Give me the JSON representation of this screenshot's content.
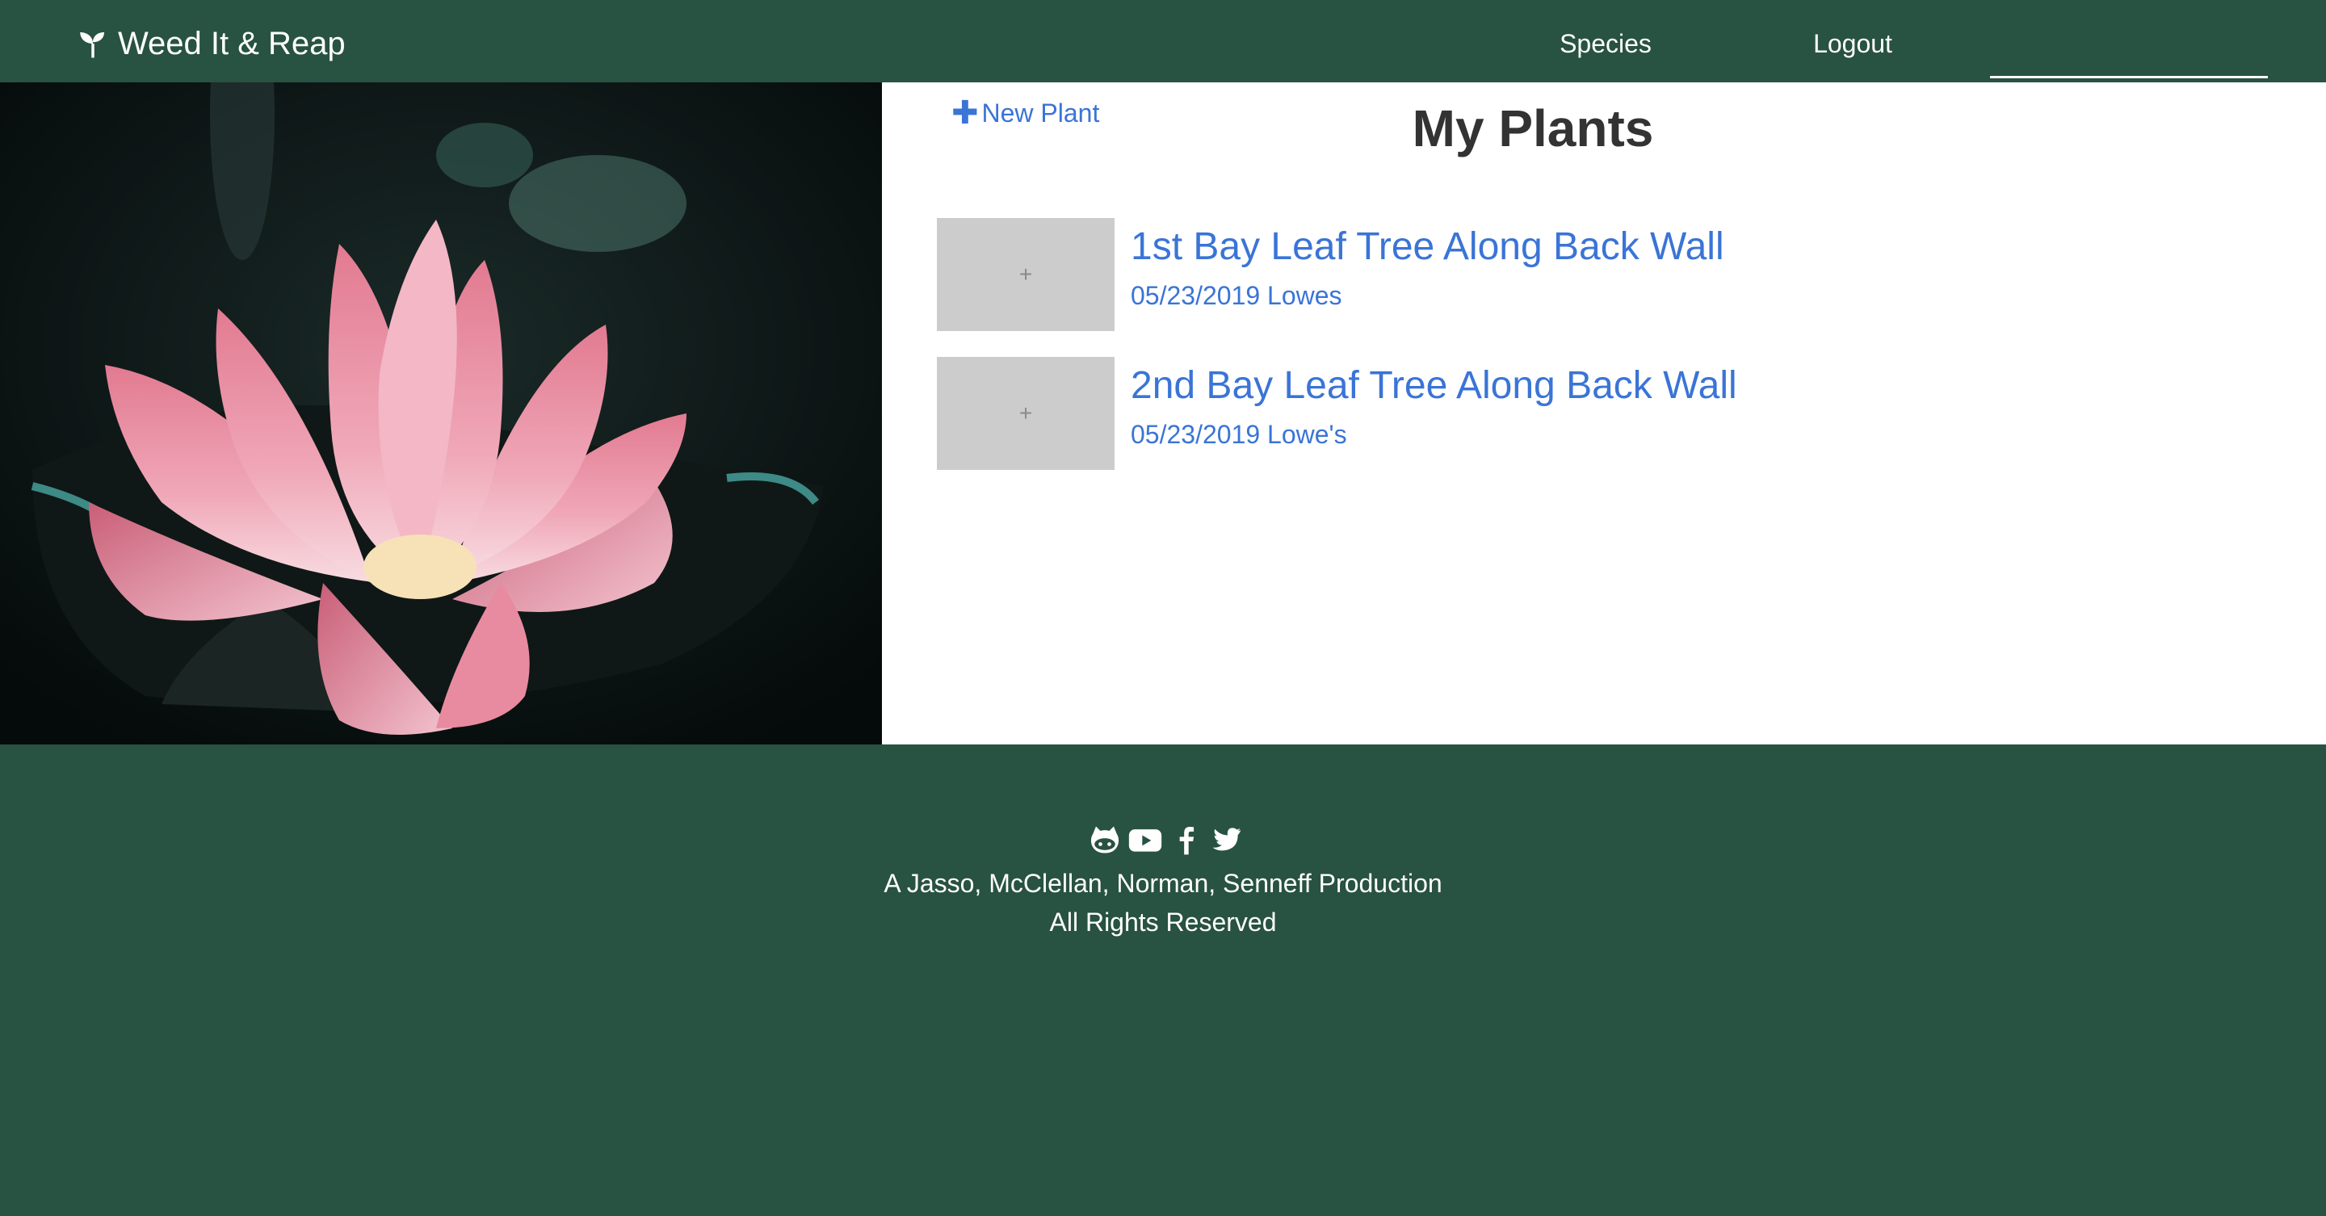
{
  "navbar": {
    "brand": "Weed It & Reap",
    "links": [
      {
        "label": "Species"
      },
      {
        "label": "Logout"
      }
    ]
  },
  "main": {
    "new_plant_label": "New Plant",
    "title": "My Plants",
    "plants": [
      {
        "name": "1st Bay Leaf Tree Along Back Wall",
        "date": "05/23/2019",
        "store": "Lowes",
        "thumb": "+"
      },
      {
        "name": "2nd Bay Leaf Tree Along Back Wall",
        "date": "05/23/2019",
        "store": "Lowe's",
        "thumb": "+"
      }
    ]
  },
  "footer": {
    "icons": [
      "github-icon",
      "youtube-icon",
      "facebook-icon",
      "twitter-icon"
    ],
    "credit": "A Jasso, McClellan, Norman, Senneff Production",
    "rights": "All Rights Reserved"
  },
  "colors": {
    "brand_green": "#285241",
    "link_blue": "#3a74d6",
    "thumb_gray": "#cccccc"
  }
}
